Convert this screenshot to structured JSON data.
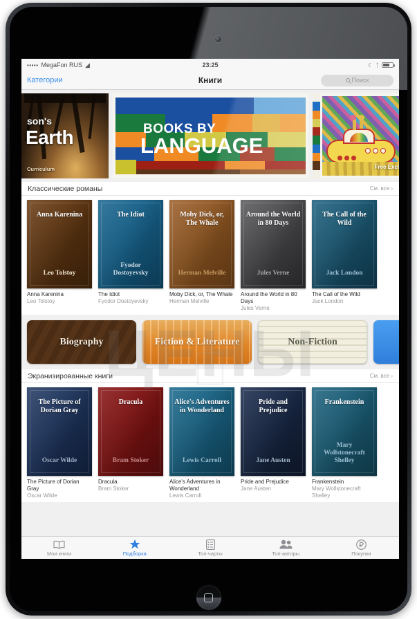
{
  "status_bar": {
    "signal_dots": "•••••",
    "carrier": "MegaFon RUS",
    "wifi_icon": "wifi-icon",
    "time": "23:25",
    "moon_icon": "do-not-disturb-icon",
    "bluetooth_icon": "bluetooth-icon",
    "battery_icon": "battery-icon"
  },
  "nav": {
    "back_label": "Категории",
    "title": "Книги",
    "search_placeholder": "Поиск"
  },
  "hero": [
    {
      "name": "earth-banner",
      "line1": "son's",
      "line2": "Earth",
      "line3": "Curriculum"
    },
    {
      "name": "books-by-language-banner",
      "line1": "BOOKS BY",
      "line2": "LANGUAGE"
    },
    {
      "name": "yellow-submarine-banner",
      "caption": "Free Exclu"
    }
  ],
  "sections": [
    {
      "title": "Классические романы",
      "more_label": "См. все ›",
      "books": [
        {
          "cover_title": "Anna Karenina",
          "cover_author": "Leo Tolstoy",
          "title": "Anna Karenina",
          "author": "Leo Tolstoy",
          "color": "cv-brown",
          "acolor": "au-cream"
        },
        {
          "cover_title": "The Idiot",
          "cover_author": "Fyodor Dostoyevsky",
          "title": "The Idiot",
          "author": "Fyodor Dostoyevsky",
          "color": "cv-blue",
          "acolor": "au-pale"
        },
        {
          "cover_title": "Moby Dick, or, The Whale",
          "cover_author": "Herman Melville",
          "title": "Moby Dick, or, The Whale",
          "author": "Herman Melville",
          "color": "cv-tan",
          "acolor": "au-tan"
        },
        {
          "cover_title": "Around the World in 80 Days",
          "cover_author": "Jules Verne",
          "title": "Around the World in 80 Days",
          "author": "Jules Verne",
          "color": "cv-gray",
          "acolor": "au-gray"
        },
        {
          "cover_title": "The Call of the Wild",
          "cover_author": "Jack London",
          "title": "The Call of the Wild",
          "author": "Jack London",
          "color": "cv-teal",
          "acolor": "au-lblue"
        }
      ]
    },
    {
      "title": "Экранизированные книги",
      "more_label": "См. все ›",
      "books": [
        {
          "cover_title": "The Picture of Dorian Gray",
          "cover_author": "Oscar Wilde",
          "title": "The Picture of Dorian Gray",
          "author": "Oscar Wilde",
          "color": "cv-navy",
          "acolor": "au-dust"
        },
        {
          "cover_title": "Dracula",
          "cover_author": "Bram Stoker",
          "title": "Dracula",
          "author": "Bram Stoker",
          "color": "cv-red",
          "acolor": "au-rose"
        },
        {
          "cover_title": "Alice's Adventures in Wonderland",
          "cover_author": "Lewis Carroll",
          "title": "Alice's Adventures in Wonderland",
          "author": "Lewis Carroll",
          "color": "cv-teal2",
          "acolor": "au-lblue"
        },
        {
          "cover_title": "Pride and Prejudice",
          "cover_author": "Jane Austen",
          "title": "Pride and Prejudice",
          "author": "Jane Austen",
          "color": "cv-dknavy",
          "acolor": "au-dust"
        },
        {
          "cover_title": "Frankenstein",
          "cover_author": "Mary Wollstonecraft Shelley",
          "title": "Frankenstein",
          "author": "Mary Wollstonecraft Shelley",
          "color": "cv-teal3",
          "acolor": "au-lblue"
        }
      ]
    }
  ],
  "categories": [
    {
      "label": "Biography",
      "style": "cat-1"
    },
    {
      "label": "Fiction & Literature",
      "style": "cat-2"
    },
    {
      "label": "Non-Fiction",
      "style": "cat-3"
    },
    {
      "label": "",
      "style": "cat-4"
    }
  ],
  "tabs": [
    {
      "label": "Мои книги",
      "icon": "open-book-icon",
      "selected": false
    },
    {
      "label": "Подборка",
      "icon": "star-icon",
      "selected": true
    },
    {
      "label": "Топ-чарты",
      "icon": "list-icon",
      "selected": false
    },
    {
      "label": "Топ-авторы",
      "icon": "people-icon",
      "selected": false
    },
    {
      "label": "Покупки",
      "icon": "ruble-circle-icon",
      "selected": false
    }
  ],
  "watermark": {
    "text": "ЦЕНЫ"
  },
  "colors": {
    "accent": "#2f7fe0",
    "link": "#3b8fe8",
    "bar": "#f7f7f7"
  }
}
